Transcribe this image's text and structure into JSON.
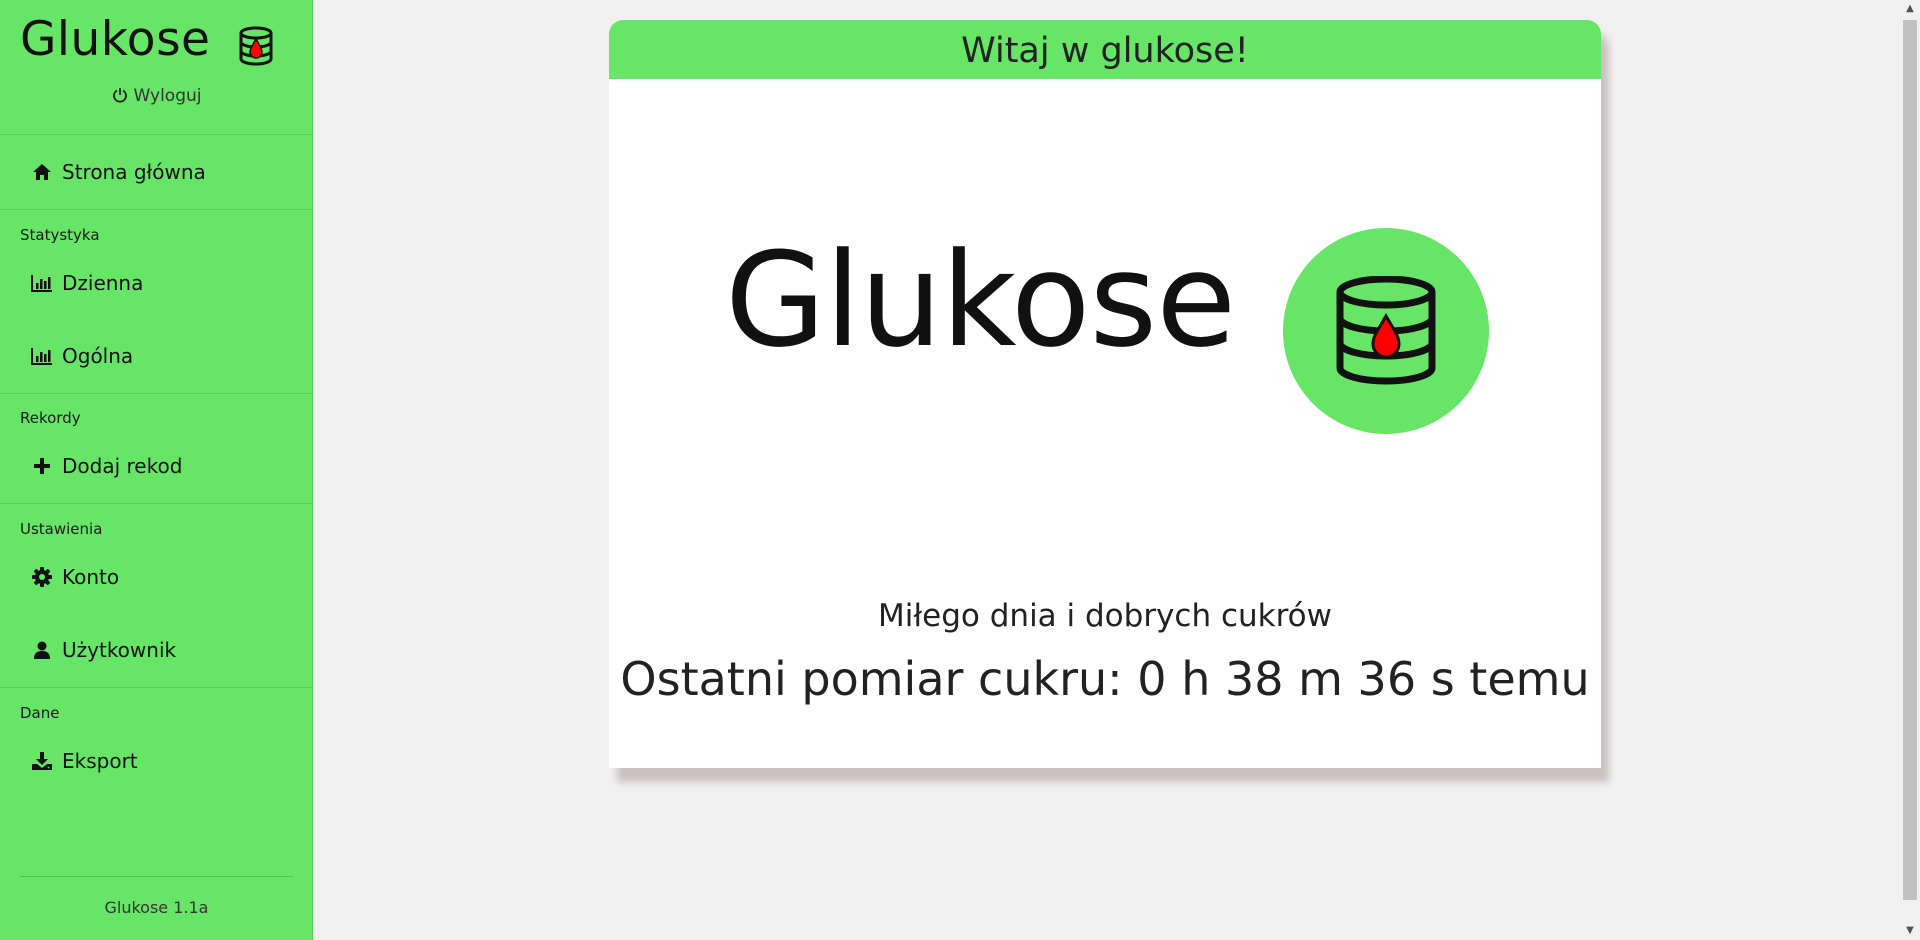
{
  "sidebar": {
    "brand": "Glukose",
    "logout_label": "Wyloguj",
    "home_label": "Strona główna",
    "sections": {
      "stats": "Statystyka",
      "records": "Rekordy",
      "settings": "Ustawienia",
      "data": "Dane"
    },
    "items": {
      "daily": "Dzienna",
      "general": "Ogólna",
      "add_record": "Dodaj rekod",
      "account": "Konto",
      "user": "Użytkownik",
      "export": "Eksport"
    },
    "version": "Glukose 1.1a"
  },
  "main": {
    "header": "Witaj w glukose!",
    "logo_text": "Glukose",
    "greeting": "Miłego dnia i dobrych cukrów",
    "last_measure": "Ostatni pomiar cukru: 0 h 38 m 36 s temu"
  },
  "colors": {
    "accent_green": "#66e566",
    "drop_red": "#ff0000"
  }
}
